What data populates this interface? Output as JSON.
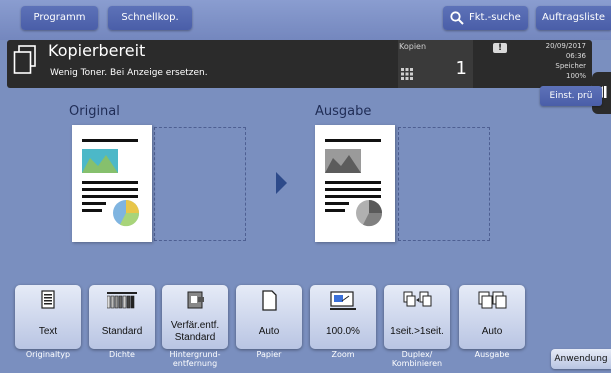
{
  "topbar": {
    "programm": "Programm",
    "schnellkop": "Schnellkop.",
    "search": "Fkt.-suche",
    "auftragsliste": "Auftragsliste"
  },
  "header": {
    "title": "Kopierbereit",
    "subtitle": "Wenig Toner. Bei Anzeige ersetzen.",
    "kopien_label": "Kopien",
    "kopien_value": "1",
    "date": "20/09/2017",
    "time": "06:36",
    "memory_label": "Speicher",
    "memory_value": "100%"
  },
  "einst_button": "Einst. prü",
  "preview": {
    "original_label": "Original",
    "ausgabe_label": "Ausgabe"
  },
  "functions": [
    {
      "value": "Text",
      "label": "Originaltyp",
      "icon": "document-text-icon"
    },
    {
      "value": "Standard",
      "label": "Dichte",
      "icon": "density-icon"
    },
    {
      "value": "Verfär.entf. Standard",
      "label": "Hintergrund-entfernung",
      "icon": "background-removal-icon"
    },
    {
      "value": "Auto",
      "label": "Papier",
      "icon": "paper-icon"
    },
    {
      "value": "100.0%",
      "label": "Zoom",
      "icon": "zoom-icon"
    },
    {
      "value": "1seit.>1seit.",
      "label": "Duplex/ Kombinieren",
      "icon": "duplex-icon"
    },
    {
      "value": "Auto",
      "label": "Ausgabe",
      "icon": "output-icon"
    }
  ],
  "anwendung": "Anwendung",
  "colors": {
    "background": "#7a8fbf",
    "header": "#2b2b2b",
    "button": "#4a5ea8",
    "function_button": "#d0d8ee"
  }
}
